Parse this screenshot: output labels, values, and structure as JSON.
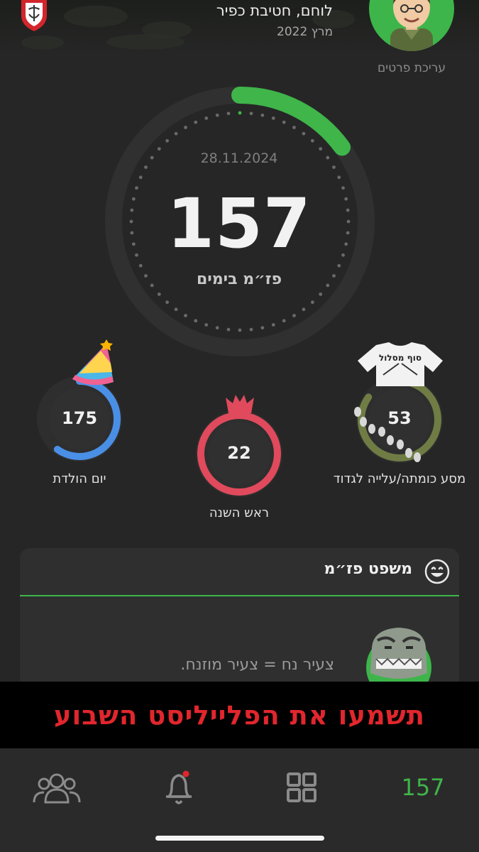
{
  "header": {
    "user_title": "לוחם, חטיבת כפיר",
    "enlist_date": "מרץ 2022",
    "edit_link": "עריכת פרטים",
    "emblem_icon": "idf-emblem-icon",
    "avatar_icon": "soldier-avatar-icon"
  },
  "countdown": {
    "date": "28.11.2024",
    "days_left": "157",
    "label": "פז״מ בימים",
    "progress_fraction": 0.15
  },
  "counters": [
    {
      "value": "175",
      "label": "יום הולדת",
      "icon": "party-hat-icon",
      "color": "#4a8fe6",
      "progress_fraction": 0.6
    },
    {
      "value": "22",
      "label": "ראש השנה",
      "icon": "pomegranate-icon",
      "color": "#e04a5c",
      "progress_fraction": 1.0
    },
    {
      "value": "53",
      "label": "מסע כומתה/עלייה לגדוד",
      "icon": "tshirt-icon",
      "tshirt_text": "סוף מסלול",
      "color": "#6f7d45",
      "progress_fraction": 0.85
    }
  ],
  "quote_card": {
    "title": "משפט פז״מ",
    "title_icon": "smile-icon",
    "quote": "צעיר נח = צעיר מוזנח.",
    "character_icon": "dinosaur-icon"
  },
  "banner": {
    "text": "תשמעו את הפלייליסט השבוע"
  },
  "bottom_nav": {
    "count": "157",
    "items": [
      "counter",
      "grid-icon",
      "bell-icon",
      "users-icon"
    ]
  },
  "colors": {
    "background": "#262626",
    "accent_green": "#3fb54a",
    "banner_red": "#e1262d"
  }
}
